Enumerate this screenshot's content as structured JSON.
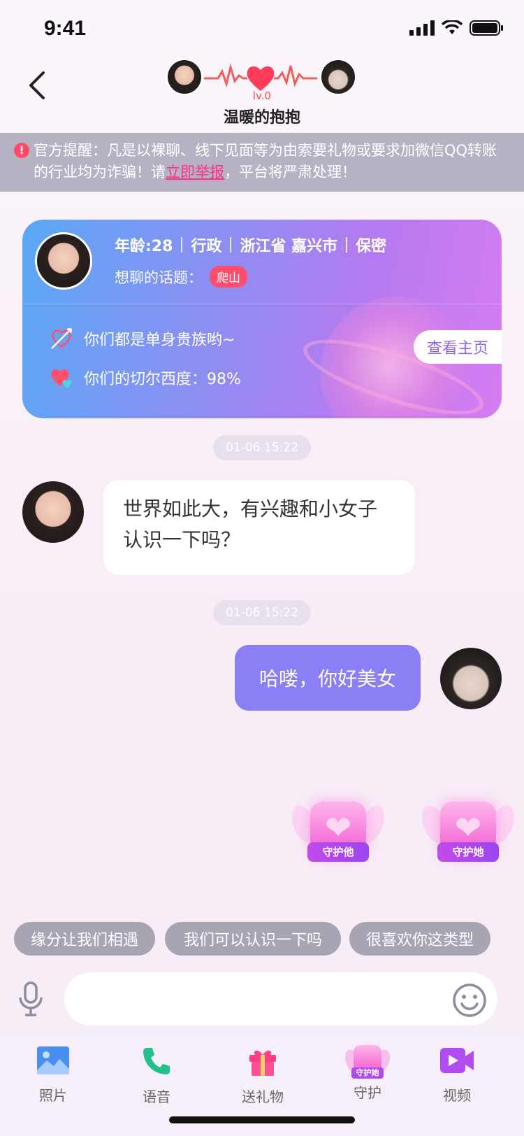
{
  "status_bar": {
    "time": "9:41"
  },
  "header": {
    "level": "lv.0",
    "title": "温暖的抱抱"
  },
  "notice": {
    "icon": "!",
    "text_before": "官方提醒：凡是以裸聊、线下见面等为由索要礼物或要求加微信QQ转账的行业均为诈骗！请",
    "link": "立即举报",
    "text_after": "，平台将严肃处理！"
  },
  "profile_card": {
    "age": "年龄:28",
    "job": "行政",
    "location": "浙江省 嘉兴市",
    "privacy": "保密",
    "topic_label": "想聊的话题：",
    "topic_tag": "爬山",
    "feature_1": "你们都是单身贵族哟~",
    "feature_2": "你们的切尔西度：98%",
    "home_button": "查看主页"
  },
  "messages": [
    {
      "timestamp": "01-06 15:22",
      "text": "世界如此大，有兴趣和小女子认识一下吗？",
      "side": "in"
    },
    {
      "timestamp": "01-06 15:22",
      "text": "哈喽，你好美女",
      "side": "out"
    }
  ],
  "guards": {
    "him": "守护他",
    "her": "守护她"
  },
  "quick_replies": [
    "缘分让我们相遇",
    "我们可以认识一下吗",
    "很喜欢你这类型"
  ],
  "tabbar": [
    {
      "label": "照片",
      "icon": "photo-icon"
    },
    {
      "label": "语音",
      "icon": "phone-icon"
    },
    {
      "label": "送礼物",
      "icon": "gift-icon"
    },
    {
      "label": "守护",
      "icon": "guard-icon",
      "badge": "守护她"
    },
    {
      "label": "视频",
      "icon": "video-icon"
    }
  ],
  "colors": {
    "accent": "#8a7ff5",
    "notice_bg": "#b7b2c3",
    "tag": "#ff4d6d",
    "link": "#ff2f88"
  }
}
